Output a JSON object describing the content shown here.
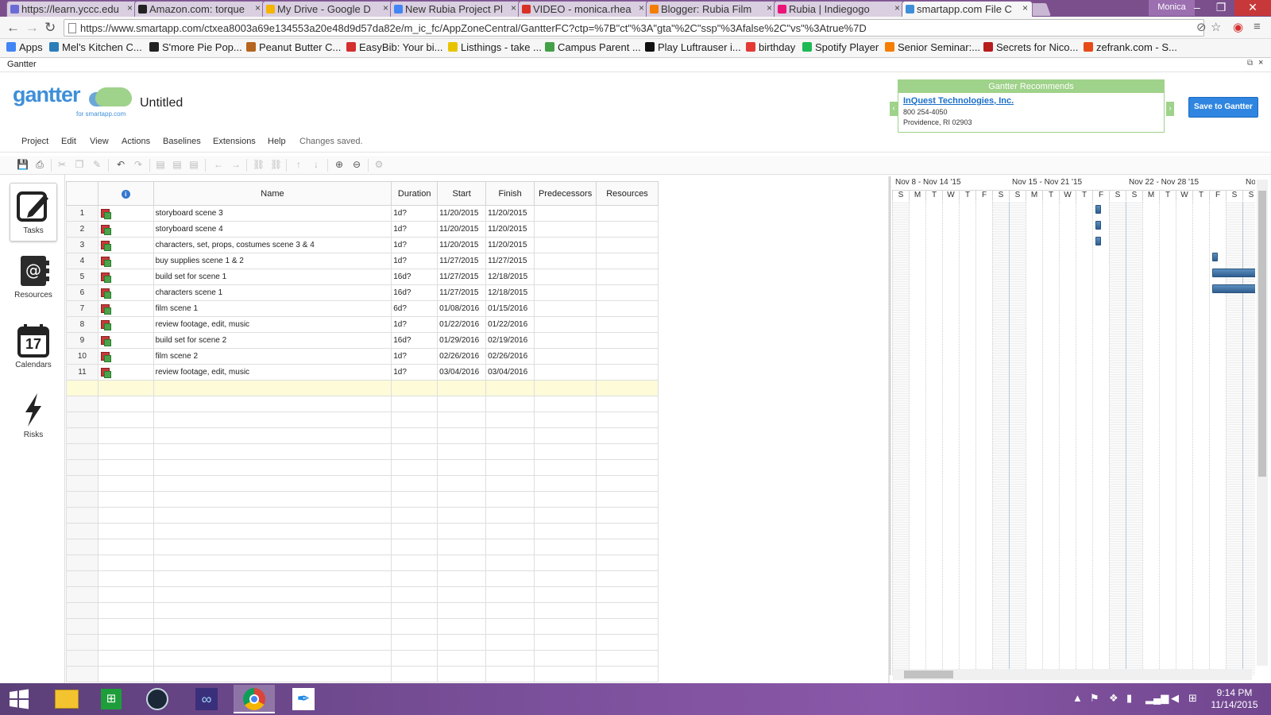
{
  "browser": {
    "tabs": [
      {
        "title": "https://learn.yccc.edu",
        "favicon_color": "#6b6bd6"
      },
      {
        "title": "Amazon.com: torque",
        "favicon_color": "#222222"
      },
      {
        "title": "My Drive - Google D",
        "favicon_color": "#f4b400"
      },
      {
        "title": "New Rubia Project Pl",
        "favicon_color": "#4285f4"
      },
      {
        "title": "VIDEO - monica.rhea",
        "favicon_color": "#d93025"
      },
      {
        "title": "Blogger: Rubia Film",
        "favicon_color": "#f57d00"
      },
      {
        "title": "Rubia | Indiegogo",
        "favicon_color": "#eb1478"
      },
      {
        "title": "smartapp.com File C",
        "favicon_color": "#3f8fd8",
        "active": true
      }
    ],
    "profile": "Monica",
    "url": "https://www.smartapp.com/ctxea8003a69e134553a20e48d9d57da82e/m_ic_fc/AppZoneCentral/GantterFC?ctp=%7B\"ct\"%3A\"gta\"%2C\"ssp\"%3Afalse%2C\"vs\"%3Atrue%7D",
    "bookmarks": [
      {
        "label": "Apps",
        "color": "#4285f4"
      },
      {
        "label": "Mel's Kitchen C...",
        "color": "#2a7db8"
      },
      {
        "label": "S'more Pie Pop...",
        "color": "#222222"
      },
      {
        "label": "Peanut Butter C...",
        "color": "#b5651d"
      },
      {
        "label": "EasyBib: Your bi...",
        "color": "#d32f2f"
      },
      {
        "label": "Listhings - take ...",
        "color": "#e8c400"
      },
      {
        "label": "Campus Parent ...",
        "color": "#43a047"
      },
      {
        "label": "Play Luftrauser i...",
        "color": "#111111"
      },
      {
        "label": "birthday",
        "color": "#e53935"
      },
      {
        "label": "Spotify Player",
        "color": "#1db954"
      },
      {
        "label": "Senior Seminar:...",
        "color": "#f57d00"
      },
      {
        "label": "Secrets for Nico...",
        "color": "#b71c1c"
      },
      {
        "label": "zefrank.com - S...",
        "color": "#e64a19"
      }
    ]
  },
  "app": {
    "window_label": "Gantter",
    "logo_text": "gantter",
    "logo_sub": "for smartapp.com",
    "doc_title": "Untitled",
    "recommend": {
      "header": "Gantter Recommends",
      "name": "InQuest Technologies, Inc.",
      "phone": "800 254-4050",
      "address": "Providence, RI 02903"
    },
    "save_button": "Save to Gantter",
    "menu": [
      "Project",
      "Edit",
      "View",
      "Actions",
      "Baselines",
      "Extensions",
      "Help"
    ],
    "status": "Changes saved.",
    "nav": [
      {
        "label": "Tasks",
        "icon": "edit-icon",
        "active": true
      },
      {
        "label": "Resources",
        "icon": "address-book-icon"
      },
      {
        "label": "Calendars",
        "icon": "calendar-icon",
        "day": "17"
      },
      {
        "label": "Risks",
        "icon": "lightning-icon"
      }
    ],
    "columns": [
      "",
      "",
      "Name",
      "Duration",
      "Start",
      "Finish",
      "Predecessors",
      "Resources"
    ],
    "tasks": [
      {
        "id": "1",
        "name": "storyboard scene 3",
        "duration": "1d?",
        "start": "11/20/2015",
        "finish": "11/20/2015"
      },
      {
        "id": "2",
        "name": "storyboard scene 4",
        "duration": "1d?",
        "start": "11/20/2015",
        "finish": "11/20/2015"
      },
      {
        "id": "3",
        "name": "characters, set, props, costumes scene 3 & 4",
        "duration": "1d?",
        "start": "11/20/2015",
        "finish": "11/20/2015"
      },
      {
        "id": "4",
        "name": "buy supplies scene 1 & 2",
        "duration": "1d?",
        "start": "11/27/2015",
        "finish": "11/27/2015"
      },
      {
        "id": "5",
        "name": "build set for scene 1",
        "duration": "16d?",
        "start": "11/27/2015",
        "finish": "12/18/2015"
      },
      {
        "id": "6",
        "name": "characters scene 1",
        "duration": "16d?",
        "start": "11/27/2015",
        "finish": "12/18/2015"
      },
      {
        "id": "7",
        "name": "film scene 1",
        "duration": "6d?",
        "start": "01/08/2016",
        "finish": "01/15/2016"
      },
      {
        "id": "8",
        "name": "review footage, edit, music",
        "duration": "1d?",
        "start": "01/22/2016",
        "finish": "01/22/2016"
      },
      {
        "id": "9",
        "name": "build set for scene 2",
        "duration": "16d?",
        "start": "01/29/2016",
        "finish": "02/19/2016"
      },
      {
        "id": "10",
        "name": "film scene 2",
        "duration": "1d?",
        "start": "02/26/2016",
        "finish": "02/26/2016"
      },
      {
        "id": "11",
        "name": "review footage, edit, music",
        "duration": "1d?",
        "start": "03/04/2016",
        "finish": "03/04/2016"
      }
    ],
    "gantt": {
      "weeks": [
        "Nov 8 - Nov 14 '15",
        "Nov 15 - Nov 21 '15",
        "Nov 22 - Nov 28 '15",
        "Nov"
      ],
      "days": [
        "S",
        "M",
        "T",
        "W",
        "T",
        "F",
        "S",
        "S",
        "M",
        "T",
        "W",
        "T",
        "F",
        "S",
        "S",
        "M",
        "T",
        "W",
        "T",
        "F",
        "S",
        "S"
      ],
      "first_day": "2015-11-08"
    }
  },
  "taskbar": {
    "time": "9:14 PM",
    "date": "11/14/2015",
    "apps": [
      "file-explorer-icon",
      "store-icon",
      "steam-icon",
      "visual-studio-icon",
      "chrome-icon",
      "quill-icon"
    ]
  }
}
